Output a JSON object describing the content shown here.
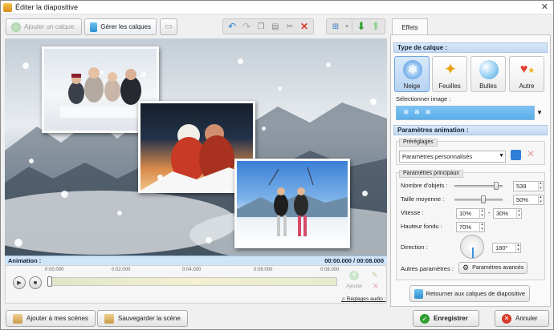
{
  "window": {
    "title": "Éditer la diapositive",
    "close_glyph": "✕"
  },
  "toolbar": {
    "add_layer_label": "Ajouter un calque",
    "manage_layers_label": "Gérer les calques"
  },
  "right_panel": {
    "tab_effects": "Effets",
    "layer_type_heading": "Type de calque :",
    "layer_types": [
      {
        "label": "Neige",
        "icon": "snowflake-icon",
        "active": true
      },
      {
        "label": "Feuilles",
        "icon": "leaf-icon",
        "active": false
      },
      {
        "label": "Bulles",
        "icon": "bubble-icon",
        "active": false
      },
      {
        "label": "Autre",
        "icon": "hearts-icon",
        "active": false
      }
    ],
    "select_image_label": "Sélectionner image :",
    "anim_params_heading": "Paramètres animation :",
    "presets_label": "Préréglages",
    "preset_value": "Paramètres personnalisés",
    "main_params_label": "Paramètres principaux",
    "params": {
      "count_label": "Nombre d'objets :",
      "count_value": "539",
      "size_label": "Taille moyenne :",
      "size_value": "50%",
      "speed_label": "Vitesse :",
      "speed_min": "10%",
      "speed_sep": "-",
      "speed_max": "30%",
      "fade_label": "Hauteur fondu :",
      "fade_value": "70%",
      "direction_label": "Direction :",
      "direction_value": "180°"
    },
    "other_params_label": "Autres paramètres :",
    "advanced_button": "Paramètres avancés",
    "back_button": "Retourner aux calques de diapositive"
  },
  "timeline": {
    "animation_label": "Animation :",
    "time_readout": "00:00.000 / 00:08.000",
    "ticks": [
      "0:00.000",
      "0:02.000",
      "0:04.000",
      "0:06.000",
      "0:08.000"
    ],
    "add_label": "Ajouter",
    "audio_settings_label": "Réglages audio :"
  },
  "footer": {
    "add_to_scenes": "Ajouter à mes scènes",
    "save_scene": "Sauvegarder la scène",
    "save": "Enregistrer",
    "cancel": "Annuler"
  },
  "colors": {
    "accent": "#3d8fe0",
    "save_green": "#2e9e2e",
    "cancel_red": "#d73a2a"
  }
}
